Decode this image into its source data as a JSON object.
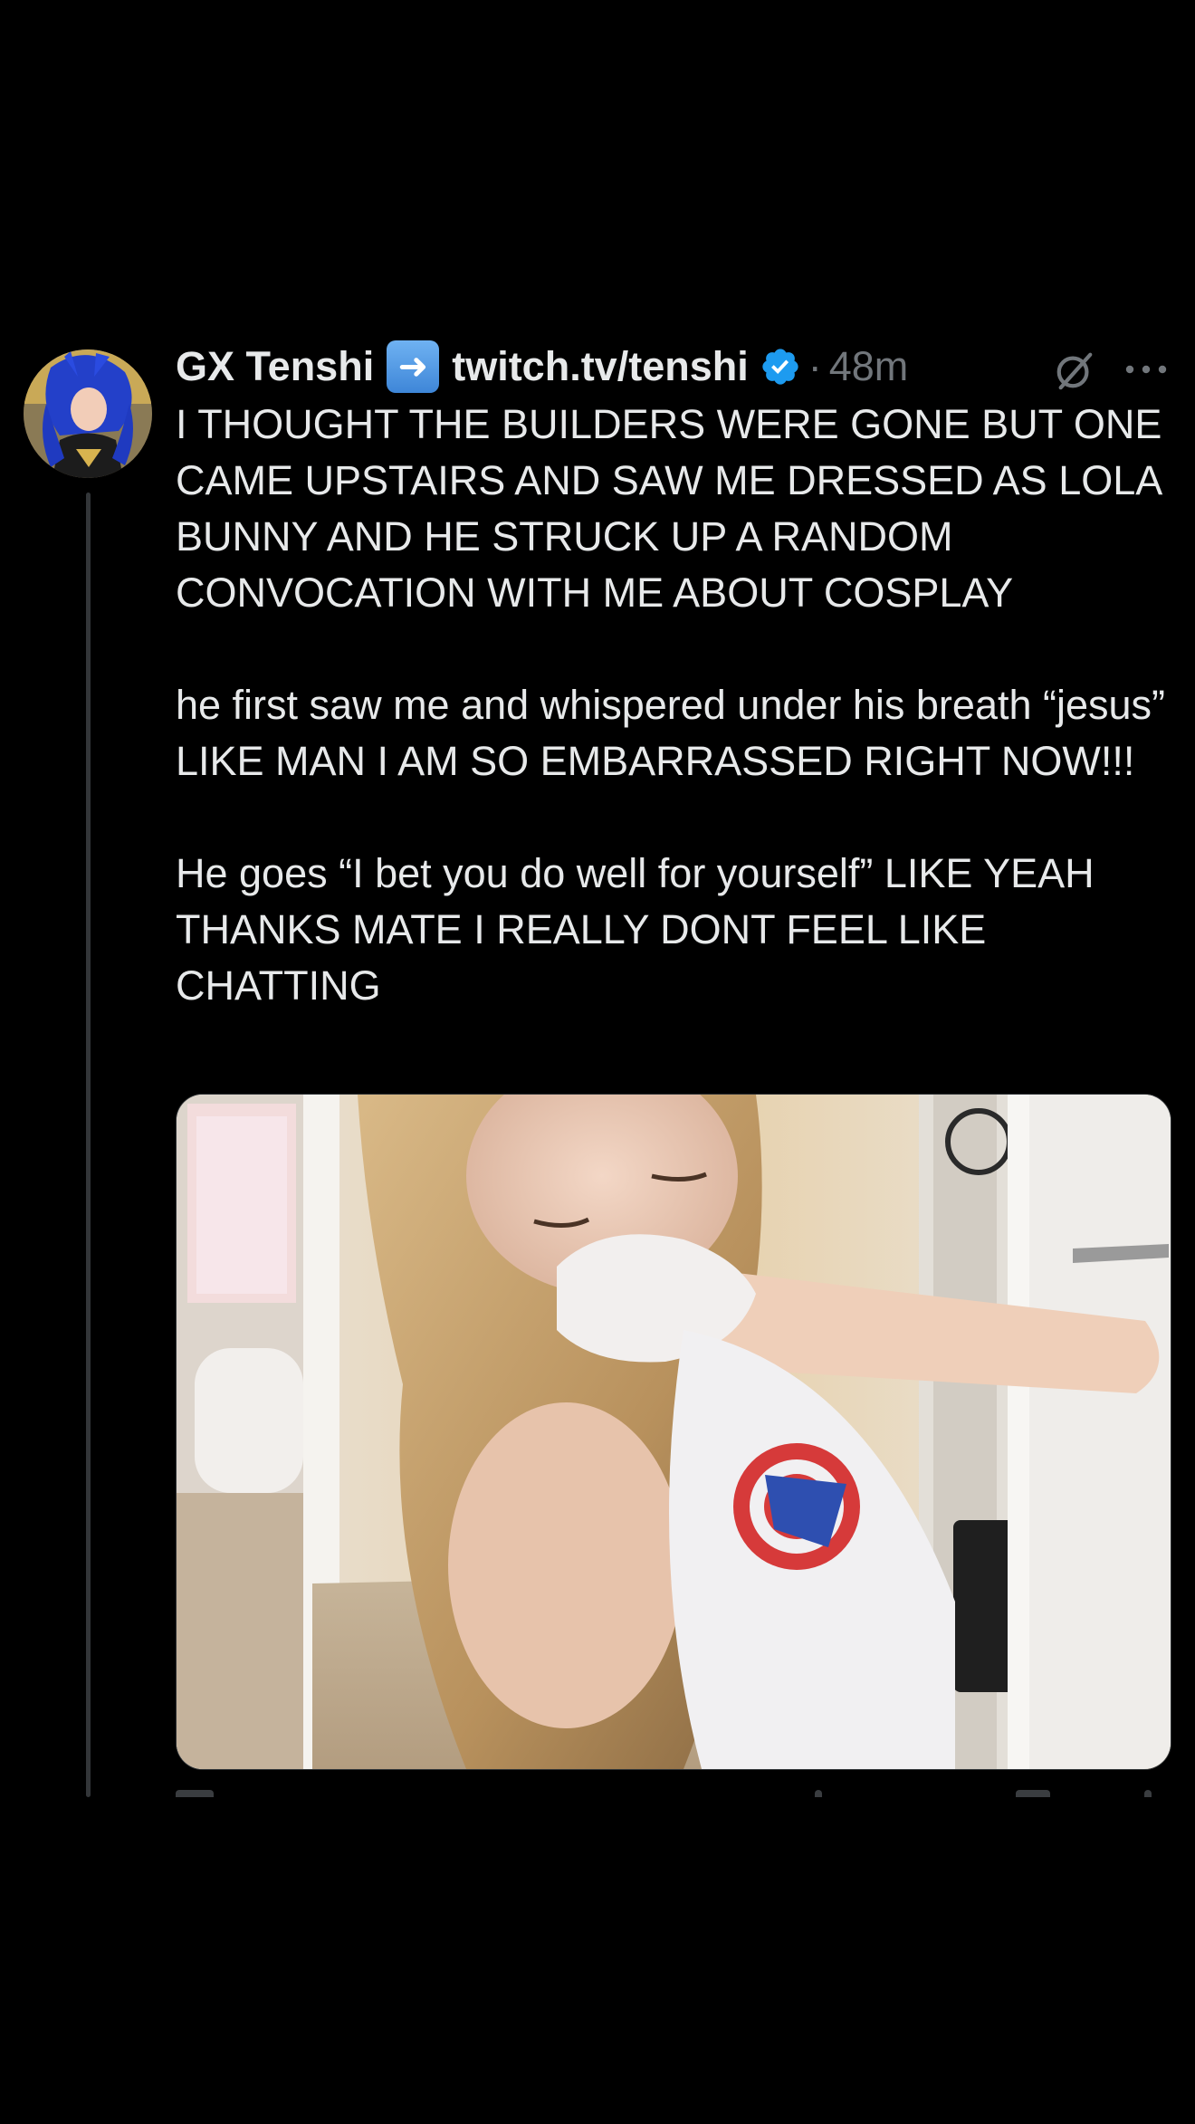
{
  "post": {
    "author": {
      "display_name": "GX Tenshi",
      "name_emoji": "➡️",
      "link_name": "twitch.tv/tenshi",
      "verified": true,
      "avatar_icon": "avatar-image"
    },
    "separator": "·",
    "timestamp": "48m",
    "text_paragraphs": [
      "I THOUGHT THE BUILDERS WERE GONE BUT ONE CAME UPSTAIRS AND SAW ME DRESSED AS LOLA BUNNY AND HE STRUCK UP A RANDOM CONVOCATION WITH ME ABOUT COSPLAY",
      "he first saw me and whispered under his breath “jesus” LIKE MAN I AM SO EMBARRASSED RIGHT NOW!!!",
      "He goes “I bet you do well for yourself” LIKE YEAH THANKS MATE I REALLY DONT FEEL LIKE CHATTING"
    ],
    "media": {
      "type": "photo"
    },
    "icons": {
      "verified": "verified-badge-icon",
      "grok": "grok-icon",
      "more": "more-options-icon"
    },
    "colors": {
      "background": "#000000",
      "text": "#e7e9ea",
      "secondary": "#71767b",
      "verified_blue": "#1d9bf0",
      "thread_line": "#333639"
    }
  }
}
